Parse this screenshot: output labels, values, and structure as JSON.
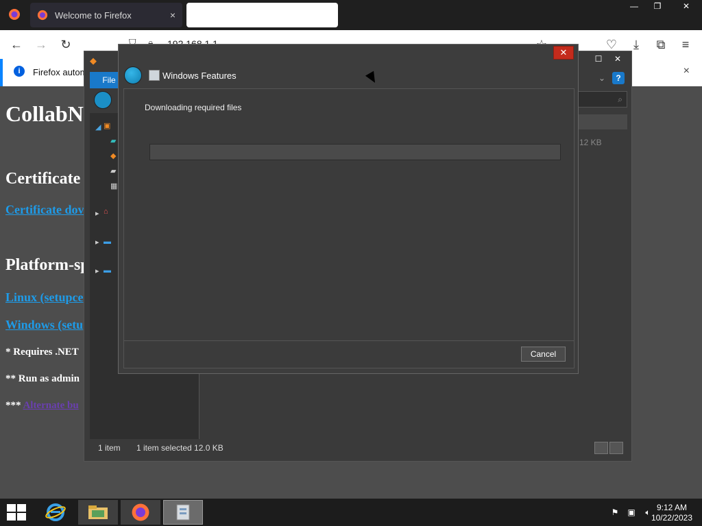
{
  "firefox": {
    "tab_title": "Welcome to Firefox",
    "tab_close": "×",
    "address": "192.168.1.1",
    "notice_text": "Firefox automa",
    "notice_close": "×",
    "window_controls": {
      "minimize": "—",
      "maximize": "❐",
      "close": "✕"
    }
  },
  "page": {
    "h1": "CollabN",
    "h2_certificate": "Certificate",
    "link_certificate": "Certificate dov",
    "h2_platform": "Platform-sp",
    "link_linux": "Linux (setupce",
    "link_windows": "Windows (setu",
    "note1": "* Requires .NET",
    "note2": "** Run as admin",
    "note3_prefix": "***",
    "note3_link": "Alternate bu"
  },
  "explorer": {
    "file_tab": "File",
    "help": "?",
    "size_col": "12 KB",
    "status_items": "1 item",
    "status_selected": "1 item selected  12.0 KB",
    "window_controls": {
      "maximize": "☐",
      "close": "✕"
    }
  },
  "dialog": {
    "title": "Windows Features",
    "status": "Downloading required files",
    "progress": 0,
    "cancel_label": "Cancel",
    "close": "✕"
  },
  "taskbar": {
    "time": "9:12 AM",
    "date": "10/22/2023"
  },
  "colors": {
    "accent": "#1979ca",
    "dialog_close": "#c42b1c",
    "link": "#1e9be8"
  }
}
